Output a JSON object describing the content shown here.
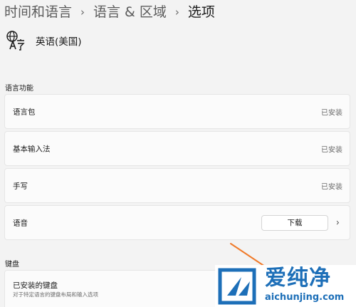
{
  "breadcrumb": {
    "level1": "时间和语言",
    "level2": "语言 & 区域",
    "current": "选项",
    "separator": "›"
  },
  "language": {
    "name": "英语(美国)",
    "icon": "language-icon"
  },
  "sections": {
    "language_features": "语言功能",
    "keyboard": "键盘"
  },
  "rows": [
    {
      "label": "语言包",
      "status": "已安装"
    },
    {
      "label": "基本输入法",
      "status": "已安装"
    },
    {
      "label": "手写",
      "status": "已安装"
    },
    {
      "label": "语音",
      "button": "下载",
      "chevron": "›"
    }
  ],
  "keyboard_row": {
    "label": "已安装的键盘",
    "description": "对于特定语言的键盘布局和输入选项"
  },
  "watermark": {
    "text": "爱纯净",
    "url": "aichunjing.com"
  },
  "colors": {
    "background": "#f3f3f3",
    "card": "#fbfbfb",
    "arrow": "#f07a2a",
    "watermark": "#1d6fb8"
  }
}
